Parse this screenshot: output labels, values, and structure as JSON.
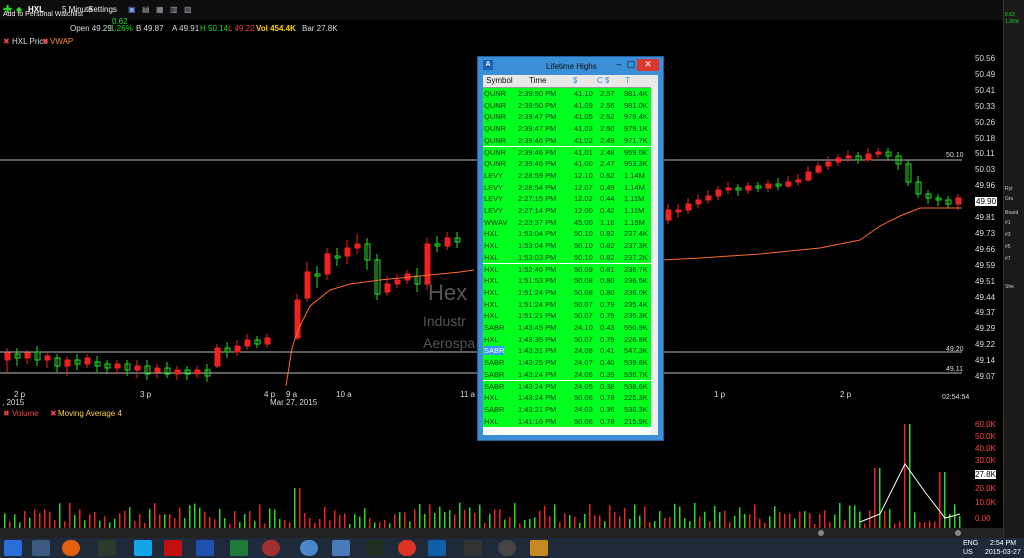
{
  "toolbar": {
    "symbol": "HXL",
    "interval": "5 Minute",
    "settings_label": "Settings",
    "add_watchlist_label": "Add to Personal Watchlist",
    "price": "49.90",
    "change": "0.62",
    "change_pct": "1.26%"
  },
  "quote": {
    "open": "Open 49.29",
    "bid": "B 49.87",
    "ask": "A 49.91",
    "high": "H 50.14",
    "low": "L 49.22",
    "volume": "Vol 454.4K",
    "bar": "Bar 27.8K"
  },
  "legend": {
    "price": "HXL Price",
    "vwap": "VWAP",
    "volume": "Volume",
    "ma": "Moving Average 4"
  },
  "watermark": {
    "symbol": "Hex",
    "sector": "Industr",
    "industry": "Aerospa"
  },
  "price_axis": [
    "50.56",
    "50.49",
    "50.41",
    "50.33",
    "50.26",
    "50.18",
    "50.11",
    "50.03",
    "49.96",
    "49.90",
    "49.81",
    "49.73",
    "49.66",
    "49.59",
    "49.51",
    "49.44",
    "49.37",
    "49.29",
    "49.22",
    "49.14",
    "49.07"
  ],
  "level_labels": {
    "upper": "50.10",
    "mid": "49.20",
    "lower": "49.11"
  },
  "time_axis": [
    "2 p",
    "3 p",
    "4 p",
    "9 a",
    "10 a",
    "11 a",
    "1 p",
    "2 p"
  ],
  "date_label": "Mar 27, 2015",
  "year_label": ", 2015",
  "clock": "02:54:54",
  "vol_axis": [
    "60.0K",
    "50.0K",
    "40.0K",
    "30.0K",
    "27.8K",
    "20.0K",
    "10.0K",
    "0.00"
  ],
  "window": {
    "title": "Lifetime Highs",
    "columns": [
      "Symbol",
      "Time",
      "$",
      "C",
      "$",
      "T"
    ],
    "rows": [
      {
        "s": "QUNR",
        "t": "2:39:50 PM",
        "p": "41.10",
        "c": "2.57",
        "v": "981.4K"
      },
      {
        "s": "QUNR",
        "t": "2:39:50 PM",
        "p": "41.09",
        "c": "2.56",
        "v": "981.0K"
      },
      {
        "s": "QUNR",
        "t": "2:39:47 PM",
        "p": "41.05",
        "c": "2.52",
        "v": "979.4K"
      },
      {
        "s": "QUNR",
        "t": "2:39:47 PM",
        "p": "41.03",
        "c": "2.50",
        "v": "979.1K"
      },
      {
        "s": "QUNR",
        "t": "2:39:46 PM",
        "p": "41.02",
        "c": "2.49",
        "v": "971.7K"
      },
      {
        "s": "QUNR",
        "t": "2:39:46 PM",
        "p": "41.01",
        "c": "2.48",
        "v": "959.0K"
      },
      {
        "s": "QUNR",
        "t": "2:39:46 PM",
        "p": "41.00",
        "c": "2.47",
        "v": "953.3K"
      },
      {
        "s": "LEVY",
        "t": "2:28:59 PM",
        "p": "12.10",
        "c": "0.52",
        "v": "1.14M"
      },
      {
        "s": "LEVY",
        "t": "2:28:54 PM",
        "p": "12.07",
        "c": "0.49",
        "v": "1.14M"
      },
      {
        "s": "LEVY",
        "t": "2:27:15 PM",
        "p": "12.02",
        "c": "0.44",
        "v": "1.11M"
      },
      {
        "s": "LEVY",
        "t": "2:27:14 PM",
        "p": "12.00",
        "c": "0.42",
        "v": "1.11M"
      },
      {
        "s": "WWAV",
        "t": "2:23:37 PM",
        "p": "45.00",
        "c": "1.18",
        "v": "1.19M"
      },
      {
        "s": "HXL",
        "t": "1:53:04 PM",
        "p": "50.10",
        "c": "0.82",
        "v": "237.4K"
      },
      {
        "s": "HXL",
        "t": "1:53:04 PM",
        "p": "50.10",
        "c": "0.82",
        "v": "237.3K"
      },
      {
        "s": "HXL",
        "t": "1:53:03 PM",
        "p": "50.10",
        "c": "0.82",
        "v": "237.2K"
      },
      {
        "s": "HXL",
        "t": "1:52:46 PM",
        "p": "50.09",
        "c": "0.81",
        "v": "236.7K"
      },
      {
        "s": "HXL",
        "t": "1:51:53 PM",
        "p": "50.08",
        "c": "0.80",
        "v": "236.6K"
      },
      {
        "s": "HXL",
        "t": "1:51:24 PM",
        "p": "50.08",
        "c": "0.80",
        "v": "236.0K"
      },
      {
        "s": "HXL",
        "t": "1:51:24 PM",
        "p": "50.07",
        "c": "0.79",
        "v": "235.4K"
      },
      {
        "s": "HXL",
        "t": "1:51:21 PM",
        "p": "50.07",
        "c": "0.79",
        "v": "235.3K"
      },
      {
        "s": "SABR",
        "t": "1:43:45 PM",
        "p": "24.10",
        "c": "0.43",
        "v": "550.9K"
      },
      {
        "s": "HXL",
        "t": "1:43:35 PM",
        "p": "50.07",
        "c": "0.79",
        "v": "226.8K"
      },
      {
        "s": "SABR",
        "t": "1:43:31 PM",
        "p": "24.08",
        "c": "0.41",
        "v": "547.3K"
      },
      {
        "s": "SABR",
        "t": "1:43:25 PM",
        "p": "24.07",
        "c": "0.40",
        "v": "539.8K"
      },
      {
        "s": "SABR",
        "t": "1:43:24 PM",
        "p": "24.06",
        "c": "0.39",
        "v": "538.7K"
      },
      {
        "s": "SABR",
        "t": "1:43:24 PM",
        "p": "24.05",
        "c": "0.38",
        "v": "538.6K"
      },
      {
        "s": "HXL",
        "t": "1:43:24 PM",
        "p": "50.06",
        "c": "0.78",
        "v": "225.3K"
      },
      {
        "s": "SABR",
        "t": "1:43:21 PM",
        "p": "24.03",
        "c": "0.36",
        "v": "538.3K"
      },
      {
        "s": "HXL",
        "t": "1:41:16 PM",
        "p": "50.06",
        "c": "0.78",
        "v": "215.9K"
      }
    ]
  },
  "right_panel": {
    "change": "0.62",
    "change_pct": "1.26%",
    "items": [
      "Ryt",
      "Gru",
      "Board",
      "#1",
      "#3",
      "#5",
      "#7",
      "She"
    ]
  },
  "taskbar": {
    "lang": "ENG",
    "region": "US",
    "time": "2:54 PM",
    "date": "2015-03-27"
  },
  "colors": {
    "up": "#22dd22",
    "down": "#ee2222",
    "vwap": "#ff6a2a",
    "row_bg": "#00ff1e",
    "window_frame": "#3a8fd6"
  }
}
